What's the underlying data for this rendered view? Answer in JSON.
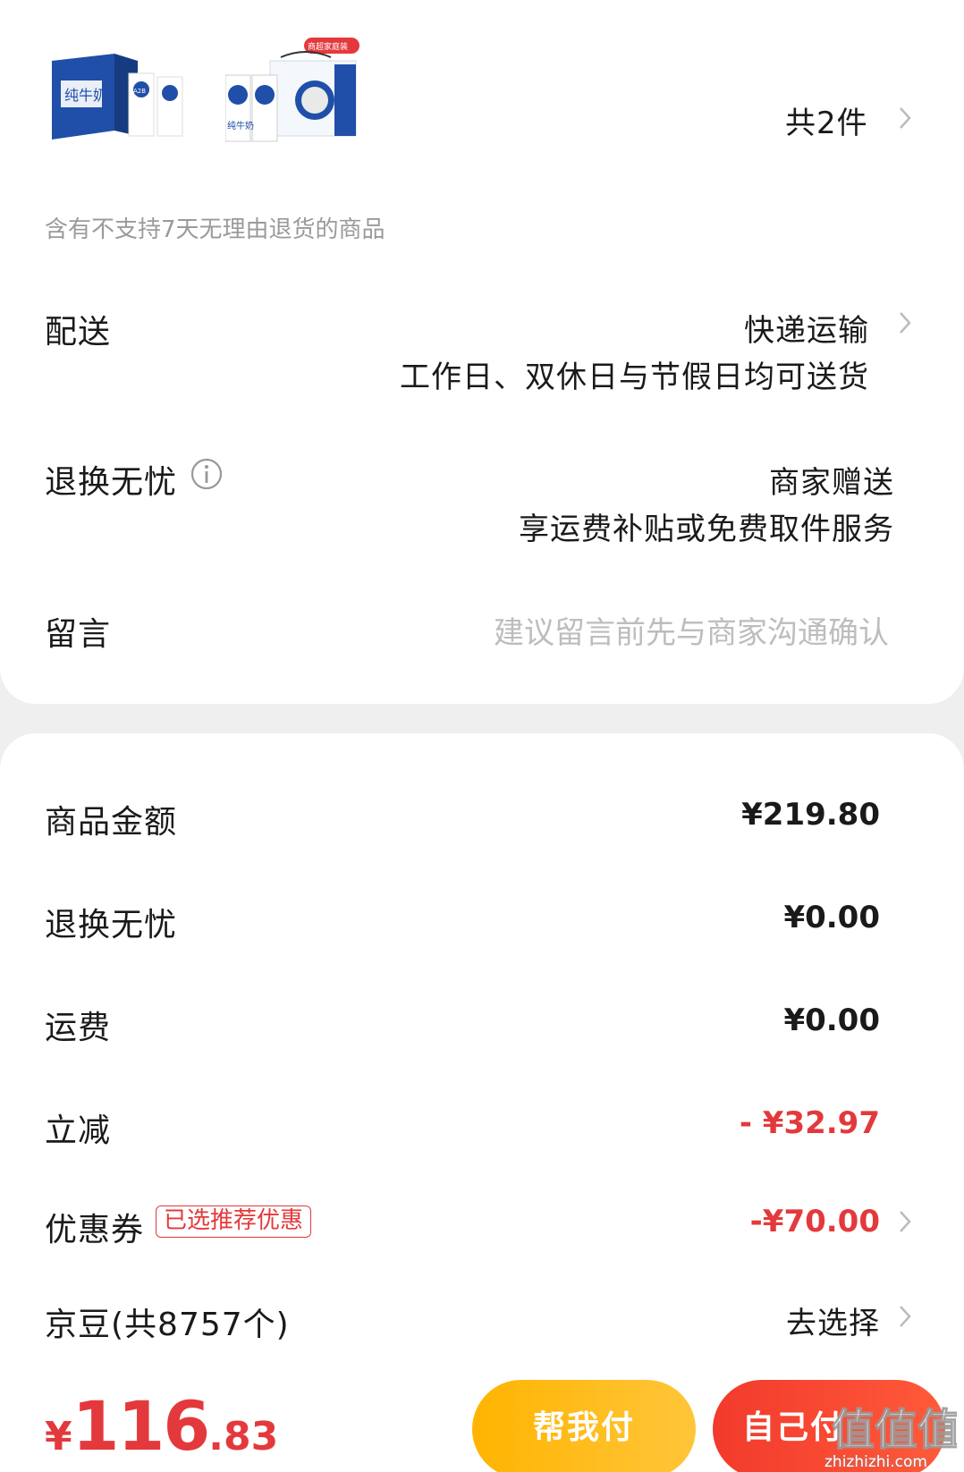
{
  "products": {
    "count_label": "共2件",
    "items": [
      {
        "name_text": "纯牛奶",
        "badge": "A2B"
      },
      {
        "name_text": "纯牛奶",
        "tag": "商超家庭装"
      }
    ]
  },
  "return_notice": "含有不支持7天无理由退货的商品",
  "delivery": {
    "label": "配送",
    "method": "快递运输",
    "note": "工作日、双休日与节假日均可送货"
  },
  "worry_free": {
    "label": "退换无忧",
    "provider": "商家赠送",
    "desc": "享运费补贴或免费取件服务"
  },
  "message": {
    "label": "留言",
    "placeholder": "建议留言前先与商家沟通确认"
  },
  "summary": {
    "goods_label": "商品金额",
    "goods_value": "¥219.80",
    "worry_label": "退换无忧",
    "worry_value": "¥0.00",
    "freight_label": "运费",
    "freight_value": "¥0.00",
    "discount_label": "立减",
    "discount_value": "- ¥32.97",
    "coupon_label": "优惠券",
    "coupon_tag": "已选推荐优惠",
    "coupon_value": "-¥70.00",
    "beans_label": "京豆(共8757个)",
    "beans_action": "去选择"
  },
  "footer": {
    "currency": "¥",
    "total_int": "116",
    "total_dec": ".83",
    "help_pay": "帮我付",
    "self_pay": "自己付"
  },
  "watermark": {
    "logo": "值值值",
    "site": "zhizhizhi.com"
  },
  "colors": {
    "accent_red": "#e4393c",
    "help_yellow": "#ffb400",
    "self_red": "#f23a2c"
  }
}
